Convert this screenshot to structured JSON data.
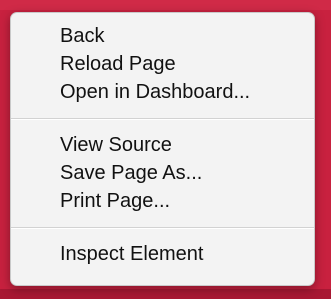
{
  "context_menu": {
    "groups": [
      {
        "items": [
          {
            "label": "Back"
          },
          {
            "label": "Reload Page"
          },
          {
            "label": "Open in Dashboard..."
          }
        ]
      },
      {
        "items": [
          {
            "label": "View Source"
          },
          {
            "label": "Save Page As..."
          },
          {
            "label": "Print Page..."
          }
        ]
      },
      {
        "items": [
          {
            "label": "Inspect Element"
          }
        ]
      }
    ]
  },
  "colors": {
    "backdrop": "#c8213f",
    "menu_background": "#f3f3f3",
    "menu_text": "#111111",
    "separator": "#d2d2d2"
  }
}
